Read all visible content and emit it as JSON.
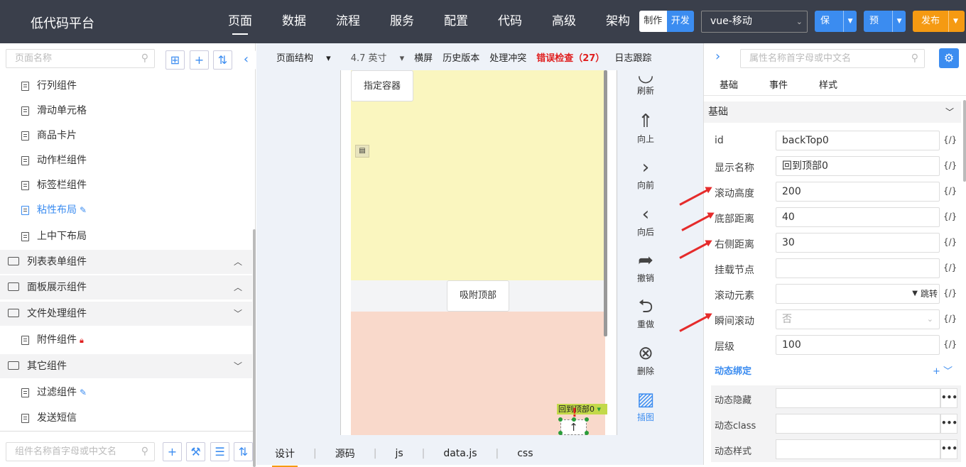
{
  "app": {
    "title": "低代码平台"
  },
  "nav": [
    "页面",
    "数据",
    "流程",
    "服务",
    "配置",
    "代码",
    "高级",
    "架构"
  ],
  "mode": {
    "make": "制作",
    "dev": "开发"
  },
  "env": {
    "value": "vue-移动"
  },
  "buttons": {
    "save": "保存",
    "preview": "预览",
    "publish": "发布"
  },
  "left": {
    "search_placeholder": "页面名称",
    "bottom_search_placeholder": "组件名称首字母或中文名",
    "items": [
      "行列组件",
      "滑动单元格",
      "商品卡片",
      "动作栏组件",
      "标签栏组件",
      "粘性布局",
      "上中下布局"
    ],
    "groups": [
      "列表表单组件",
      "面板展示组件",
      "文件处理组件",
      "其它组件"
    ],
    "sub_items": [
      "附件组件",
      "过滤组件",
      "发送短信"
    ]
  },
  "toolbar": {
    "structure": "页面结构",
    "size": "4.7 英寸",
    "landscape": "横屏",
    "history": "历史版本",
    "conflict": "处理冲突",
    "error_check": "错误检查（27）",
    "log": "日志跟踪"
  },
  "canvas": {
    "container_btn": "指定容器",
    "sticky_btn": "吸附顶部",
    "backtop_label": "回到顶部0",
    "backtop_icon": "↑"
  },
  "actions": [
    "刷新",
    "向上",
    "向前",
    "向后",
    "撤销",
    "重做",
    "删除",
    "插图"
  ],
  "bottom_tabs": [
    "设计",
    "源码",
    "js",
    "data.js",
    "css"
  ],
  "right": {
    "search_placeholder": "属性名称首字母或中文名",
    "tabs": [
      "基础",
      "事件",
      "样式"
    ],
    "section": "基础",
    "props": [
      {
        "key": "id",
        "value": "backTop0"
      },
      {
        "key": "显示名称",
        "value": "回到顶部0"
      },
      {
        "key": "滚动高度",
        "value": "200"
      },
      {
        "key": "底部距离",
        "value": "40"
      },
      {
        "key": "右侧距离",
        "value": "30"
      },
      {
        "key": "挂载节点",
        "value": ""
      },
      {
        "key": "滚动元素",
        "value": ""
      },
      {
        "key": "瞬间滚动",
        "value": "否"
      },
      {
        "key": "层级",
        "value": "100"
      }
    ],
    "jump": "跳转",
    "fx": "{/}",
    "dynamic": {
      "title": "动态绑定",
      "rows": [
        "动态隐藏",
        "动态class",
        "动态样式"
      ],
      "dots": "•••"
    }
  },
  "colors": {
    "accent": "#3b8cf0",
    "publish": "#f59a12",
    "topbar": "#3a3f4b",
    "error": "#e02020"
  }
}
